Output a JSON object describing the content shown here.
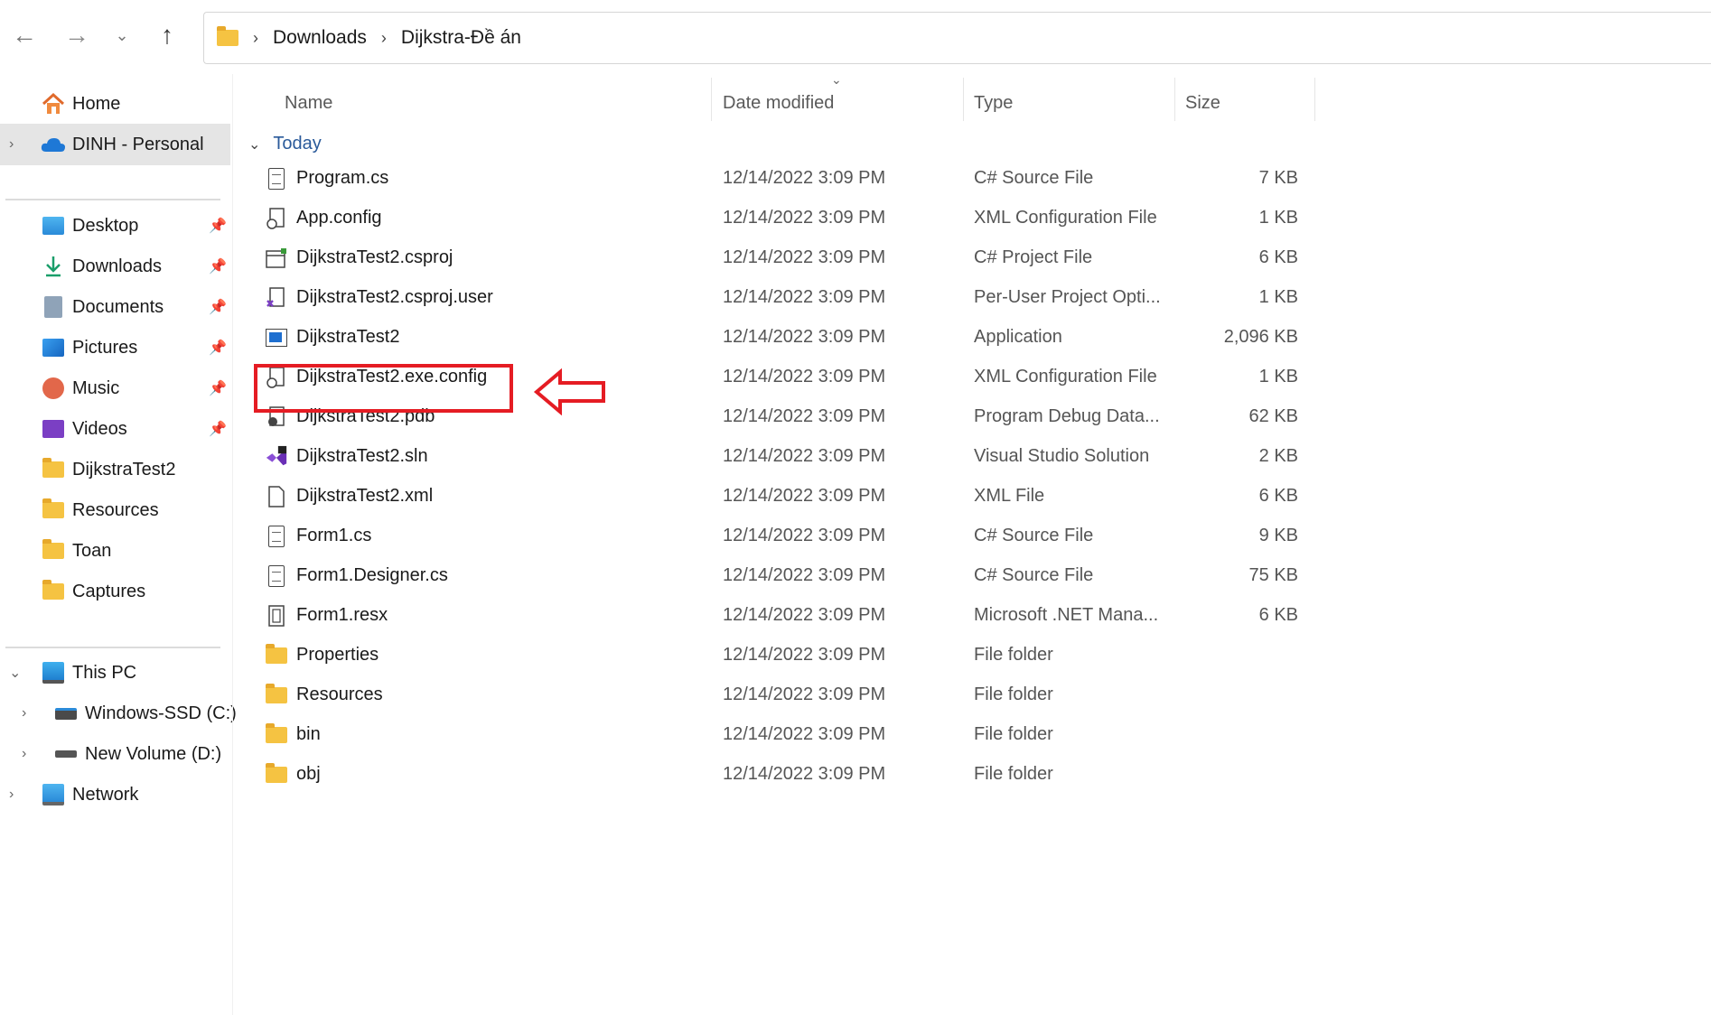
{
  "nav": {
    "back_icon": "arrow-left-icon",
    "forward_icon": "arrow-right-icon",
    "recent_icon": "chevron-down-icon",
    "up_icon": "arrow-up-icon"
  },
  "address": {
    "segments": [
      "Downloads",
      "Dijkstra-Đề án"
    ]
  },
  "sidebar": {
    "home": "Home",
    "onedrive": "DINH - Personal",
    "quick_access": [
      {
        "label": "Desktop",
        "icon": "desktop-icon"
      },
      {
        "label": "Downloads",
        "icon": "download-icon"
      },
      {
        "label": "Documents",
        "icon": "documents-icon"
      },
      {
        "label": "Pictures",
        "icon": "pictures-icon"
      },
      {
        "label": "Music",
        "icon": "music-icon"
      },
      {
        "label": "Videos",
        "icon": "videos-icon"
      },
      {
        "label": "DijkstraTest2",
        "icon": "folder-icon"
      },
      {
        "label": "Resources",
        "icon": "folder-icon"
      },
      {
        "label": "Toan",
        "icon": "folder-icon"
      },
      {
        "label": "Captures",
        "icon": "folder-icon"
      }
    ],
    "this_pc": "This PC",
    "drives": [
      "Windows-SSD (C:)",
      "New Volume (D:)"
    ],
    "network": "Network"
  },
  "columns": {
    "name": "Name",
    "date": "Date modified",
    "type": "Type",
    "size": "Size"
  },
  "group": "Today",
  "files": [
    {
      "name": "Program.cs",
      "date": "12/14/2022 3:09 PM",
      "type": "C# Source File",
      "size": "7 KB",
      "icon": "csharp-file-icon"
    },
    {
      "name": "App.config",
      "date": "12/14/2022 3:09 PM",
      "type": "XML Configuration File",
      "size": "1 KB",
      "icon": "config-file-icon"
    },
    {
      "name": "DijkstraTest2.csproj",
      "date": "12/14/2022 3:09 PM",
      "type": "C# Project File",
      "size": "6 KB",
      "icon": "csproj-file-icon"
    },
    {
      "name": "DijkstraTest2.csproj.user",
      "date": "12/14/2022 3:09 PM",
      "type": "Per-User Project Opti...",
      "size": "1 KB",
      "icon": "user-project-file-icon"
    },
    {
      "name": "DijkstraTest2",
      "date": "12/14/2022 3:09 PM",
      "type": "Application",
      "size": "2,096 KB",
      "icon": "application-icon"
    },
    {
      "name": "DijkstraTest2.exe.config",
      "date": "12/14/2022 3:09 PM",
      "type": "XML Configuration File",
      "size": "1 KB",
      "icon": "config-file-icon"
    },
    {
      "name": "DijkstraTest2.pdb",
      "date": "12/14/2022 3:09 PM",
      "type": "Program Debug Data...",
      "size": "62 KB",
      "icon": "pdb-file-icon"
    },
    {
      "name": "DijkstraTest2.sln",
      "date": "12/14/2022 3:09 PM",
      "type": "Visual Studio Solution",
      "size": "2 KB",
      "icon": "visual-studio-solution-icon"
    },
    {
      "name": "DijkstraTest2.xml",
      "date": "12/14/2022 3:09 PM",
      "type": "XML File",
      "size": "6 KB",
      "icon": "blank-file-icon"
    },
    {
      "name": "Form1.cs",
      "date": "12/14/2022 3:09 PM",
      "type": "C# Source File",
      "size": "9 KB",
      "icon": "csharp-file-icon"
    },
    {
      "name": "Form1.Designer.cs",
      "date": "12/14/2022 3:09 PM",
      "type": "C# Source File",
      "size": "75 KB",
      "icon": "csharp-file-icon"
    },
    {
      "name": "Form1.resx",
      "date": "12/14/2022 3:09 PM",
      "type": "Microsoft .NET Mana...",
      "size": "6 KB",
      "icon": "resx-file-icon"
    },
    {
      "name": "Properties",
      "date": "12/14/2022 3:09 PM",
      "type": "File folder",
      "size": "",
      "icon": "folder-icon"
    },
    {
      "name": "Resources",
      "date": "12/14/2022 3:09 PM",
      "type": "File folder",
      "size": "",
      "icon": "folder-icon"
    },
    {
      "name": "bin",
      "date": "12/14/2022 3:09 PM",
      "type": "File folder",
      "size": "",
      "icon": "folder-icon"
    },
    {
      "name": "obj",
      "date": "12/14/2022 3:09 PM",
      "type": "File folder",
      "size": "",
      "icon": "folder-icon"
    }
  ],
  "annotation": {
    "highlighted_file": "DijkstraTest2",
    "color": "#e51c23"
  },
  "colors": {
    "folder": "#f5c342",
    "selected_bg": "#e5e5e5",
    "group_text": "#2a5a9a"
  }
}
